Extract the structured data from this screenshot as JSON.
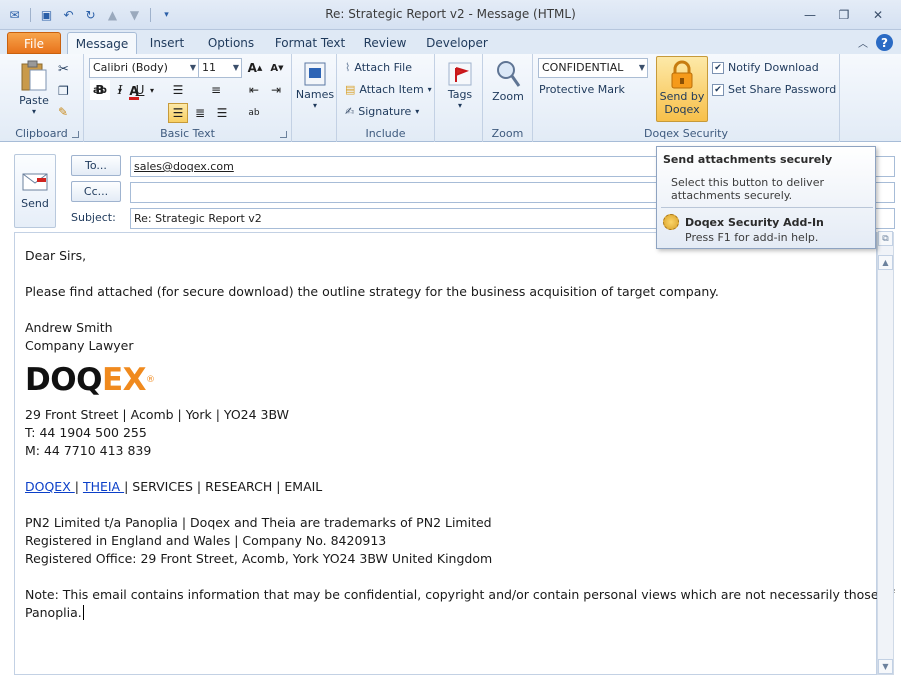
{
  "window": {
    "title": "Re: Strategic Report v2  -  Message (HTML)"
  },
  "tabs": [
    {
      "label": "File"
    },
    {
      "label": "Message"
    },
    {
      "label": "Insert"
    },
    {
      "label": "Options"
    },
    {
      "label": "Format Text"
    },
    {
      "label": "Review"
    },
    {
      "label": "Developer"
    }
  ],
  "ribbon": {
    "clipboard": {
      "label": "Clipboard",
      "paste": "Paste"
    },
    "basic_text": {
      "label": "Basic Text",
      "font": "Calibri (Body)",
      "size": "11"
    },
    "names": {
      "label": "Names"
    },
    "include": {
      "label": "Include",
      "attach_file": "Attach File",
      "attach_item": "Attach Item",
      "signature": "Signature"
    },
    "tags": {
      "label": "Tags"
    },
    "zoom": {
      "label": "Zoom",
      "zoom_btn": "Zoom"
    },
    "doqex": {
      "label": "Doqex Security",
      "mark_value": "CONFIDENTIAL",
      "protective_mark": "Protective Mark",
      "send_line1": "Send by",
      "send_line2": "Doqex",
      "notify_download": "Notify Download",
      "set_share_password": "Set Share Password"
    }
  },
  "header": {
    "send": "Send",
    "to_btn": "To...",
    "cc_btn": "Cc...",
    "subject_label": "Subject:",
    "to_value": "sales@doqex.com",
    "cc_value": "",
    "subject_value": "Re: Strategic Report v2"
  },
  "tooltip": {
    "title": "Send attachments securely",
    "desc": "Select this button to deliver attachments securely.",
    "addin": "Doqex Security Add-In",
    "help": "Press F1 for add-in help."
  },
  "body": {
    "greeting": "Dear Sirs,",
    "line1": "Please find attached (for secure download) the outline strategy for the business acquisition of target company.",
    "name": "Andrew Smith",
    "role": "Company Lawyer",
    "logo_a": "DOQ",
    "logo_b": "EX",
    "logo_r": "®",
    "addr": "29 Front Street | Acomb | York | YO24 3BW",
    "tel": "T: 44 1904 500 255",
    "mob": "M: 44 7710 413 839",
    "link1": "DOQEX ",
    "sep1": " | ",
    "link2": "THEIA ",
    "rest": " | SERVICES | RESEARCH | EMAIL",
    "pn1": "PN2 Limited t/a Panoplia | Doqex and Theia are trademarks of PN2 Limited",
    "pn2": "Registered in England and Wales | Company No. 8420913",
    "pn3": "Registered Office: 29 Front Street, Acomb, York YO24 3BW United Kingdom",
    "note1": "Note: This email contains information that may be confidential, copyright and/or contain personal views which are not necessarily those of",
    "note2": "Panoplia."
  }
}
